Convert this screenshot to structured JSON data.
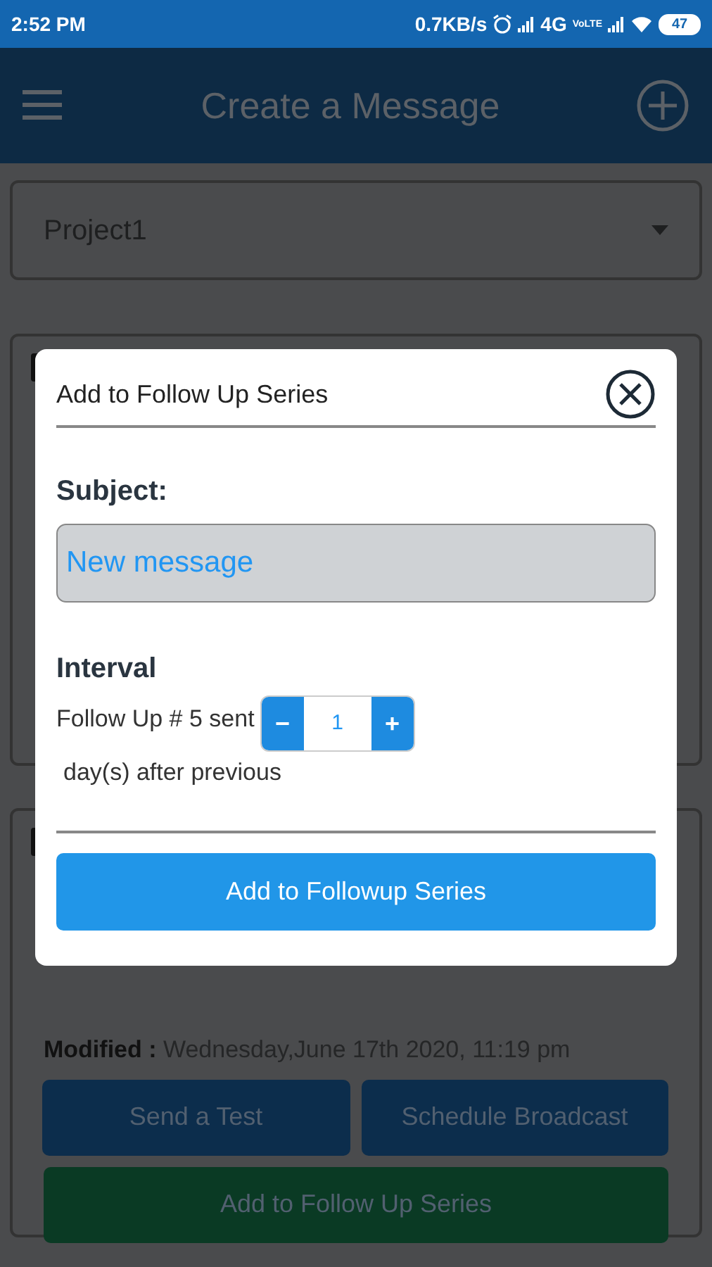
{
  "status_bar": {
    "time": "2:52 PM",
    "speed": "0.7KB/s",
    "network": "4G",
    "volte": "VoLTE",
    "battery": "47"
  },
  "app_bar": {
    "title": "Create a Message"
  },
  "project_select": {
    "value": "Project1"
  },
  "message_cards": [
    {
      "kind": "covered"
    },
    {
      "kind": "details",
      "modified_label": "Modified :",
      "modified": "Wednesday,June 17th 2020, 11:19 pm",
      "buttons": [
        "Send a Test",
        "Schedule Broadcast"
      ],
      "follow_up_button": "Add to Follow Up Series"
    }
  ],
  "dialog": {
    "title": "Add to Follow Up Series",
    "subject_label": "Subject:",
    "subject_value": "New message",
    "interval_label": "Interval",
    "follow_up_text": "Follow Up # 5 sent",
    "stepper": {
      "minus": "−",
      "value": "1",
      "plus": "+"
    },
    "after_text": "day(s) after previous",
    "submit": "Add to Followup Series"
  }
}
